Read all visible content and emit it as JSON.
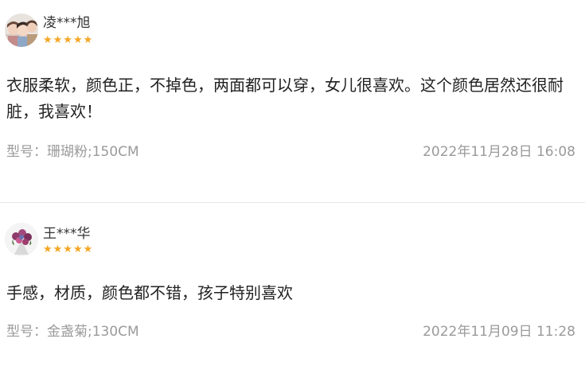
{
  "reviews": [
    {
      "username": "凌***旭",
      "stars": "★★★★★",
      "rating": 5,
      "content": "衣服柔软，颜色正，不掉色，两面都可以穿，女儿很喜欢。这个颜色居然还很耐脏，我喜欢！",
      "spec_label": "型号：",
      "spec_value": "珊瑚粉;150CM",
      "date": "2022年11月28日 16:08"
    },
    {
      "username": "王***华",
      "stars": "★★★★★",
      "rating": 5,
      "content": "手感，材质，颜色都不错，孩子特别喜欢",
      "spec_label": "型号：",
      "spec_value": "金盏菊;130CM",
      "date": "2022年11月09日 11:28"
    }
  ],
  "colors": {
    "star": "#f5a623",
    "meta_text": "#9a9a9a",
    "body_text": "#222222",
    "divider": "#e6e6e6"
  }
}
